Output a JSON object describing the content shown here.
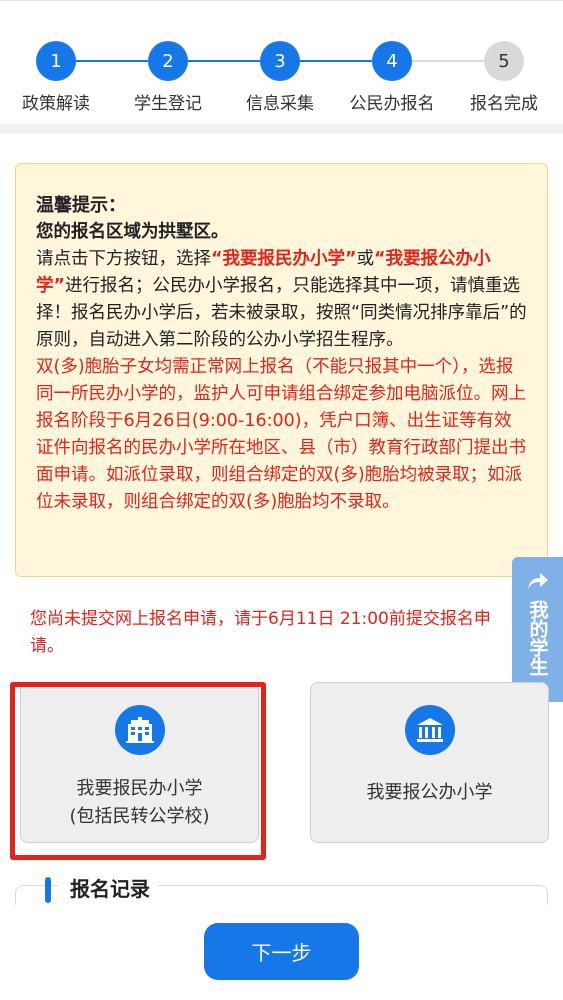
{
  "stepper": {
    "steps": [
      {
        "num": "1",
        "label": "政策解读"
      },
      {
        "num": "2",
        "label": "学生登记"
      },
      {
        "num": "3",
        "label": "信息采集"
      },
      {
        "num": "4",
        "label": "公民办报名"
      },
      {
        "num": "5",
        "label": "报名完成"
      }
    ],
    "active_color": "#1677e8",
    "inactive_color": "#d9d9d9"
  },
  "notice": {
    "title": "温馨提示：",
    "zone": "您的报名区域为拱墅区。",
    "p1_a": "请点击下方按钮，选择",
    "p1_hl1": "“我要报民办小学”",
    "p1_b": "或",
    "p1_hl2": "“我要报公办小学”",
    "p1_c": "进行报名；公民办小学报名，只能选择其中一项，请慎重选择！报名民办小学后，若未被录取，按照“同类情况排序靠后”的原则，自动进入第二阶段的公办小学招生程序。",
    "warning": "双(多)胞胎子女均需正常网上报名（不能只报其中一个），选报同一所民办小学的，监护人可申请组合绑定参加电脑派位。网上报名阶段于6月26日(9:00-16:00)，凭户口簿、出生证等有效证件向报名的民办小学所在地区、县（市）教育行政部门提出书面申请。如派位录取，则组合绑定的双(多)胞胎均被录取；如派位未录取，则组合绑定的双(多)胞胎均不录取。"
  },
  "side_tab": {
    "label": "我的学生",
    "icon": "share-arrow-icon"
  },
  "deadline_text": "您尚未提交网上报名申请，请于6月11日 21:00前提交报名申请。",
  "cards": {
    "private": {
      "line1": "我要报民办小学",
      "line2": "(包括民转公学校)",
      "icon": "school-building-icon"
    },
    "public": {
      "line1": "我要报公办小学",
      "icon": "government-building-icon"
    }
  },
  "records": {
    "title": "报名记录"
  },
  "footer": {
    "next_label": "下一步"
  },
  "colors": {
    "accent": "#1677e8",
    "alert": "#e1251b",
    "notice_bg": "#fff6dc"
  }
}
